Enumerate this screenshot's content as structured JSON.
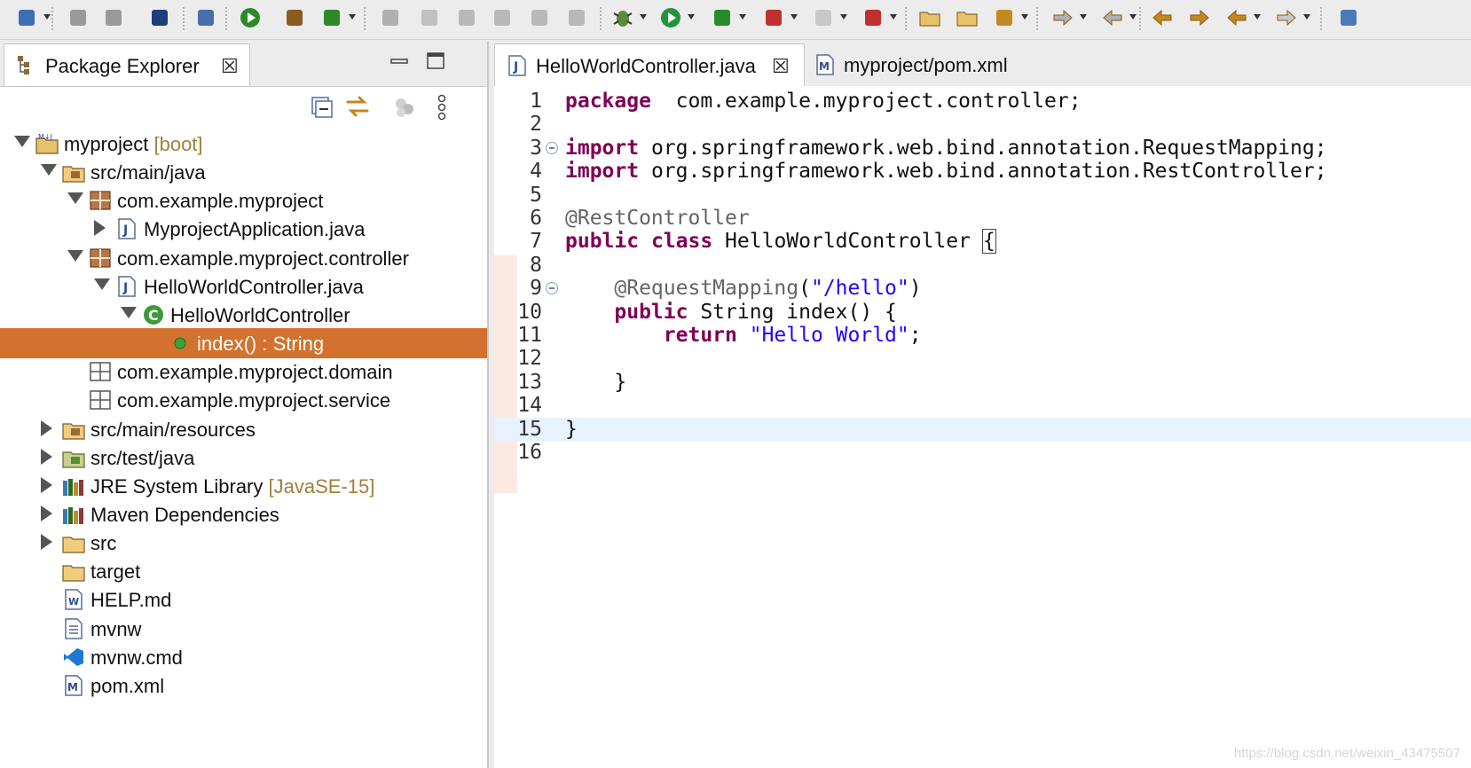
{
  "toolbar": {
    "buttons": [
      "new-icon",
      "save-icon",
      "save-all-icon",
      "terminal-icon",
      "search-icon",
      "spring-boot-dashboard-icon",
      "new-package-icon",
      "new-class-icon",
      "open-type-icon",
      "pen-icon",
      "gears-icon",
      "refresh-icon",
      "doc-icon",
      "pilcrow-icon",
      "debug-icon",
      "run-icon",
      "run-config-icon",
      "coverage-icon",
      "stop-icon",
      "external-tools-icon",
      "open-folder-icon",
      "open-project-icon",
      "pencil-icon",
      "next-annotation-icon",
      "prev-annotation-icon",
      "last-edit-icon",
      "forward-edit-icon",
      "back-icon",
      "forward-icon",
      "perspective-icon"
    ]
  },
  "explorer": {
    "tab_title": "Package Explorer",
    "tab_close": "☒",
    "tree": [
      {
        "label": "myproject",
        "decoration": "[boot]",
        "depth": 0,
        "twisty": "open",
        "icon": "maven-project-icon"
      },
      {
        "label": "src/main/java",
        "decoration": "",
        "depth": 1,
        "twisty": "open",
        "icon": "source-folder-icon"
      },
      {
        "label": "com.example.myproject",
        "decoration": "",
        "depth": 2,
        "twisty": "open",
        "icon": "package-icon"
      },
      {
        "label": "MyprojectApplication.java",
        "decoration": "",
        "depth": 3,
        "twisty": "closed",
        "icon": "java-file-icon"
      },
      {
        "label": "com.example.myproject.controller",
        "decoration": "",
        "depth": 2,
        "twisty": "open",
        "icon": "package-icon"
      },
      {
        "label": "HelloWorldController.java",
        "decoration": "",
        "depth": 3,
        "twisty": "open",
        "icon": "java-file-icon"
      },
      {
        "label": "HelloWorldController",
        "decoration": "",
        "depth": 4,
        "twisty": "open",
        "icon": "class-icon"
      },
      {
        "label": "index() : String",
        "decoration": "",
        "depth": 5,
        "twisty": "none",
        "icon": "method-icon",
        "selected": true
      },
      {
        "label": "com.example.myproject.domain",
        "decoration": "",
        "depth": 2,
        "twisty": "none",
        "icon": "empty-package-icon"
      },
      {
        "label": "com.example.myproject.service",
        "decoration": "",
        "depth": 2,
        "twisty": "none",
        "icon": "empty-package-icon"
      },
      {
        "label": "src/main/resources",
        "decoration": "",
        "depth": 1,
        "twisty": "closed",
        "icon": "source-folder-icon"
      },
      {
        "label": "src/test/java",
        "decoration": "",
        "depth": 1,
        "twisty": "closed",
        "icon": "test-folder-icon"
      },
      {
        "label": "JRE System Library",
        "decoration": "[JavaSE-15]",
        "depth": 1,
        "twisty": "closed",
        "icon": "library-icon"
      },
      {
        "label": "Maven Dependencies",
        "decoration": "",
        "depth": 1,
        "twisty": "closed",
        "icon": "library-icon"
      },
      {
        "label": "src",
        "decoration": "",
        "depth": 1,
        "twisty": "closed",
        "icon": "folder-icon"
      },
      {
        "label": "target",
        "decoration": "",
        "depth": 1,
        "twisty": "none",
        "icon": "folder-icon"
      },
      {
        "label": "HELP.md",
        "decoration": "",
        "depth": 1,
        "twisty": "none",
        "icon": "markdown-file-icon"
      },
      {
        "label": "mvnw",
        "decoration": "",
        "depth": 1,
        "twisty": "none",
        "icon": "text-file-icon"
      },
      {
        "label": "mvnw.cmd",
        "decoration": "",
        "depth": 1,
        "twisty": "none",
        "icon": "vscode-file-icon"
      },
      {
        "label": "pom.xml",
        "decoration": "",
        "depth": 1,
        "twisty": "none",
        "icon": "maven-file-icon"
      }
    ]
  },
  "editor": {
    "tabs": [
      {
        "label": "HelloWorldController.java",
        "icon": "java-file-icon",
        "active": true,
        "close": "☒"
      },
      {
        "label": "myproject/pom.xml",
        "icon": "maven-file-icon",
        "active": false
      }
    ],
    "current_line": 15,
    "lines": [
      {
        "n": "1",
        "tokens": [
          [
            "kw",
            "package"
          ],
          [
            "",
            "  com.example.myproject.controller;"
          ]
        ]
      },
      {
        "n": "2",
        "tokens": []
      },
      {
        "n": "3",
        "fold": true,
        "tokens": [
          [
            "kw",
            "import"
          ],
          [
            "",
            " org.springframework.web.bind.annotation.RequestMapping;"
          ]
        ]
      },
      {
        "n": "4",
        "tokens": [
          [
            "kw",
            "import"
          ],
          [
            "",
            " org.springframework.web.bind.annotation.RestController;"
          ]
        ]
      },
      {
        "n": "5",
        "tokens": []
      },
      {
        "n": "6",
        "tokens": [
          [
            "ann",
            "@RestController"
          ]
        ]
      },
      {
        "n": "7",
        "tokens": [
          [
            "kw",
            "public"
          ],
          [
            "",
            " "
          ],
          [
            "kw",
            "class"
          ],
          [
            "",
            " HelloWorldController "
          ],
          [
            "bracket",
            "{"
          ]
        ]
      },
      {
        "n": "8",
        "tokens": []
      },
      {
        "n": "9",
        "fold": true,
        "tokens": [
          [
            "",
            "    "
          ],
          [
            "ann",
            "@RequestMapping"
          ],
          [
            "",
            "("
          ],
          [
            "str",
            "\"/hello\""
          ],
          [
            "",
            ")"
          ]
        ]
      },
      {
        "n": "10",
        "tokens": [
          [
            "",
            "    "
          ],
          [
            "kw",
            "public"
          ],
          [
            "",
            " String index() {"
          ]
        ]
      },
      {
        "n": "11",
        "tokens": [
          [
            "",
            "        "
          ],
          [
            "kw",
            "return"
          ],
          [
            "",
            " "
          ],
          [
            "str",
            "\"Hello World\""
          ],
          [
            "",
            ";"
          ]
        ]
      },
      {
        "n": "12",
        "tokens": []
      },
      {
        "n": "13",
        "tokens": [
          [
            "",
            "    }"
          ]
        ]
      },
      {
        "n": "14",
        "tokens": []
      },
      {
        "n": "15",
        "tokens": [
          [
            "",
            "}"
          ]
        ]
      },
      {
        "n": "16",
        "tokens": []
      }
    ]
  },
  "watermark": "https://blog.csdn.net/weixin_43475507"
}
